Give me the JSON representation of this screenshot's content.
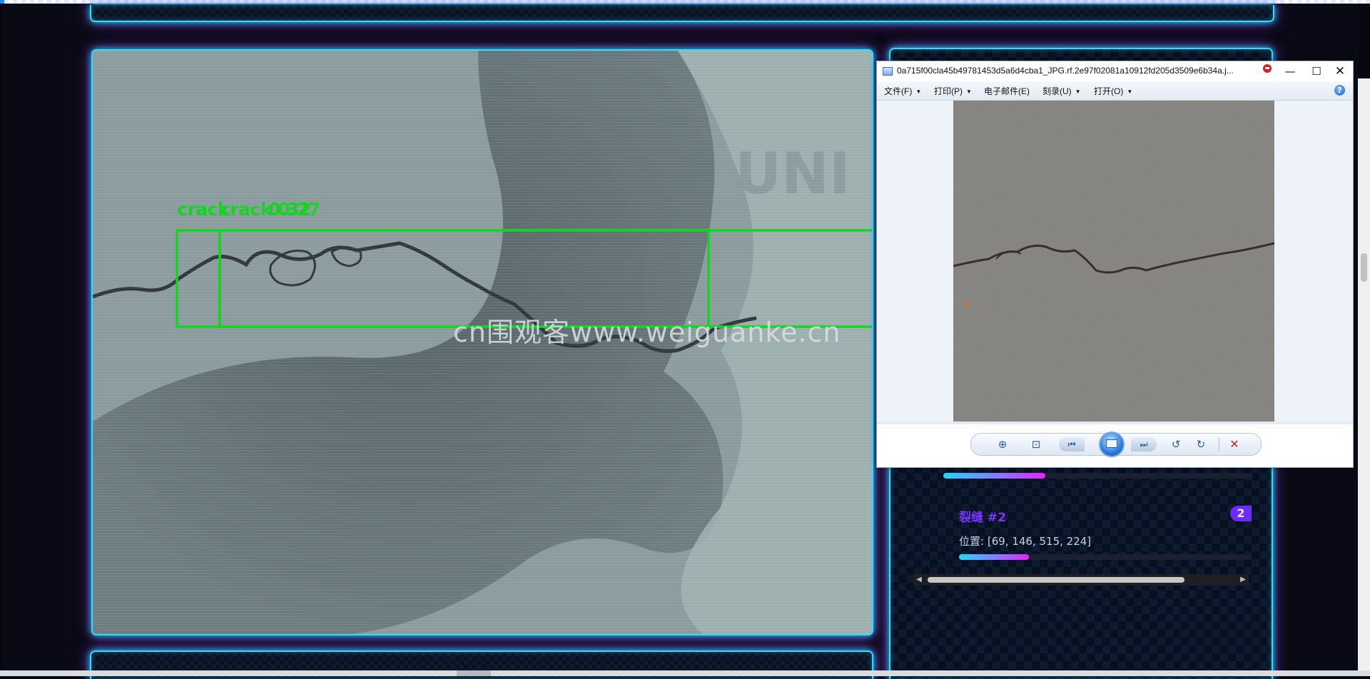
{
  "detection": {
    "labels": [
      "crack",
      "crack 0.27",
      "0.32"
    ],
    "watermark": "cn围观客www.weiguanke.cn"
  },
  "results": {
    "item_title": "裂缝 #2",
    "item_badge": "2",
    "position_label": "位置:",
    "position_value": "[69, 146, 515, 224]",
    "confidence_fraction_first": 0.33,
    "confidence_fraction_second": 0.24
  },
  "photo_viewer": {
    "title": "0a715f00cla45b49781453d5a6d4cba1_JPG.rf.2e97f02081a10912fd205d3509e6b34a.j...",
    "menu": [
      "文件(F)",
      "打印(P)",
      "电子邮件(E)",
      "刻录(U)",
      "打开(O)"
    ],
    "help_glyph": "?",
    "window_controls": {
      "minimize": "—",
      "maximize": "☐",
      "close": "✕"
    }
  },
  "colors": {
    "neon_cyan": "#28e1ff",
    "neon_purple": "#a03cff",
    "detection_green": "#12d61e",
    "result_title": "#7a34ff"
  },
  "icons": {
    "zoom": "zoom-in-icon",
    "fit": "fit-window-icon",
    "prev": "previous-icon",
    "slideshow": "slideshow-icon",
    "next": "next-icon",
    "rotate_left": "rotate-left-icon",
    "rotate_right": "rotate-right-icon",
    "delete": "delete-icon"
  }
}
